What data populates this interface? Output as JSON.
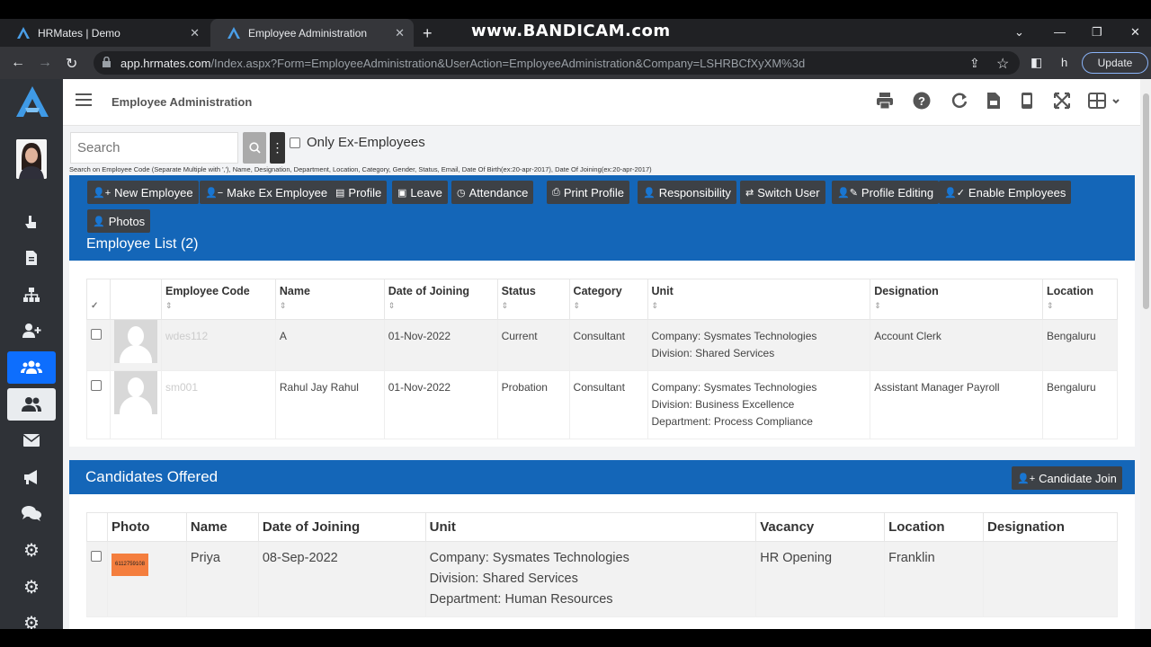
{
  "browser": {
    "tabs": [
      {
        "label": "HRMates | Demo"
      },
      {
        "label": "Employee Administration"
      }
    ],
    "watermark": "www.BANDICAM.com",
    "url_domain": "app.hrmates.com",
    "url_path": "/Index.aspx?Form=EmployeeAdministration&UserAction=EmployeeAdministration&Company=LSHRBCfXyXM%3d",
    "profile_initial": "h",
    "update_label": "Update"
  },
  "header": {
    "title": "Employee Administration"
  },
  "search": {
    "placeholder": "Search",
    "only_ex_label": "Only Ex-Employees",
    "hint": "Search on Employee Code (Separate Multiple with ','), Name, Designation, Department, Location, Category, Gender, Status, Email, Date Of Birth(ex:20-apr-2017), Date Of Joining(ex:20-apr-2017)"
  },
  "actions": [
    {
      "label": "New Employee"
    },
    {
      "label": "Make Ex Employee"
    },
    {
      "label": "Profile"
    },
    {
      "label": "Leave"
    },
    {
      "label": "Attendance"
    },
    {
      "label": "Print Profile"
    },
    {
      "label": "Responsibility"
    },
    {
      "label": "Switch User"
    },
    {
      "label": "Profile Editing"
    },
    {
      "label": "Enable Employees"
    },
    {
      "label": "Photos"
    }
  ],
  "employee_list": {
    "title": "Employee List (2)",
    "columns": [
      "Employee Code",
      "Name",
      "Date of Joining",
      "Status",
      "Category",
      "Unit",
      "Designation",
      "Location"
    ],
    "rows": [
      {
        "code": "wdes112",
        "name": "A",
        "doj": "01-Nov-2022",
        "status": "Current",
        "category": "Consultant",
        "unit": [
          "Company: Sysmates Technologies",
          "Division: Shared Services"
        ],
        "designation": "Account Clerk",
        "location": "Bengaluru"
      },
      {
        "code": "sm001",
        "name": "Rahul Jay Rahul",
        "doj": "01-Nov-2022",
        "status": "Probation",
        "category": "Consultant",
        "unit": [
          "Company: Sysmates Technologies",
          "Division: Business Excellence",
          "Department: Process Compliance"
        ],
        "designation": "Assistant Manager Payroll",
        "location": "Bengaluru"
      }
    ]
  },
  "candidates": {
    "title": "Candidates Offered",
    "join_button": "Candidate Join",
    "columns": [
      "Photo",
      "Name",
      "Date of Joining",
      "Unit",
      "Vacancy",
      "Location",
      "Designation"
    ],
    "rows": [
      {
        "photo_tag": "6112759108",
        "name": "Priya",
        "doj": "08-Sep-2022",
        "unit": [
          "Company: Sysmates Technologies",
          "Division: Shared Services",
          "Department: Human Resources"
        ],
        "vacancy": "HR Opening",
        "location": "Franklin",
        "designation": ""
      }
    ]
  },
  "colors": {
    "accent": "#1466b8",
    "dark_button": "#3d4146",
    "sidebar": "#2f3237",
    "active_nav": "#0d6efd"
  }
}
